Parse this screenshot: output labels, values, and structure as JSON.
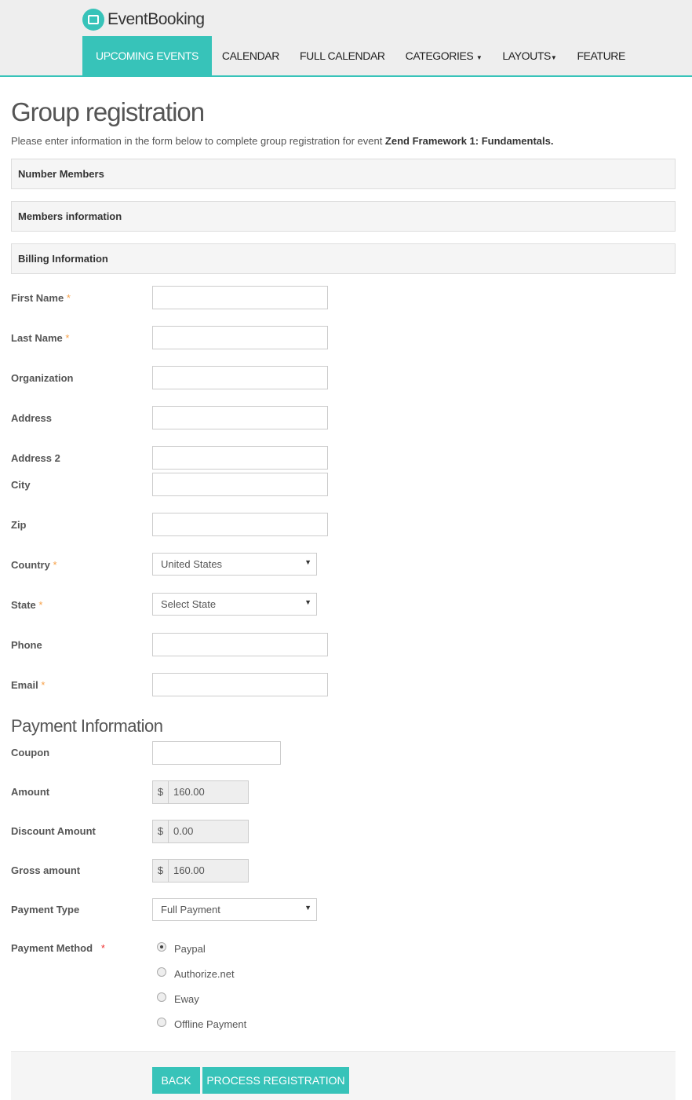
{
  "brand": {
    "name": "EventBooking",
    "accent": "#37c3b9"
  },
  "nav": [
    {
      "label": "UPCOMING EVENTS",
      "active": true
    },
    {
      "label": "CALENDAR"
    },
    {
      "label": "FULL CALENDAR"
    },
    {
      "label": "CATEGORIES",
      "dropdown": true
    },
    {
      "label": "LAYOUTS",
      "dropdown": true
    },
    {
      "label": "FEATURE"
    }
  ],
  "page": {
    "title": "Group registration",
    "intro": "Please enter information in the form below to complete group registration for event ",
    "event": "Zend Framework 1: Fundamentals."
  },
  "panels": [
    "Number Members",
    "Members information",
    "Billing Information"
  ],
  "billing": {
    "first_name": "First Name",
    "last_name": "Last Name",
    "organization": "Organization",
    "address": "Address",
    "address2": "Address 2",
    "city": "City",
    "zip": "Zip",
    "country": "Country",
    "country_value": "United States",
    "state": "State",
    "state_value": "Select State",
    "phone": "Phone",
    "email": "Email"
  },
  "payment": {
    "heading": "Payment Information",
    "coupon": "Coupon",
    "amount": "Amount",
    "amount_value": "160.00",
    "discount": "Discount Amount",
    "discount_value": "0.00",
    "gross": "Gross amount",
    "gross_value": "160.00",
    "currency": "$",
    "type": "Payment Type",
    "type_value": "Full Payment",
    "method": "Payment Method",
    "methods": [
      {
        "label": "Paypal",
        "checked": true
      },
      {
        "label": "Authorize.net"
      },
      {
        "label": "Eway"
      },
      {
        "label": "Offline Payment"
      }
    ]
  },
  "required_mark": "*",
  "buttons": {
    "back": "BACK",
    "process": "PROCESS REGISTRATION"
  }
}
